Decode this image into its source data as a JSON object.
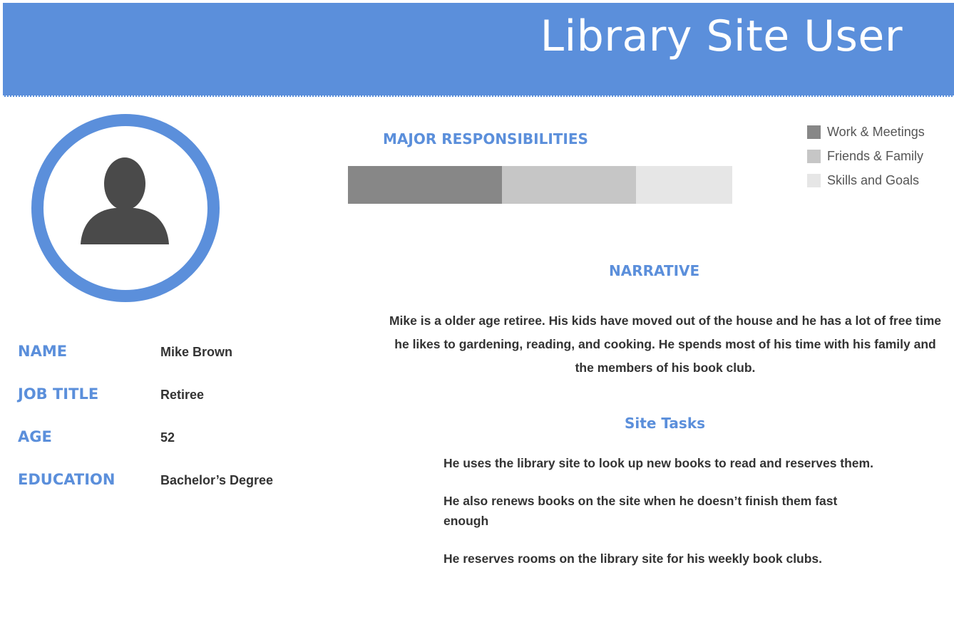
{
  "header": {
    "title": "Library Site User"
  },
  "avatar": {
    "icon": "user-silhouette-icon"
  },
  "profile": [
    {
      "label": "NAME",
      "value": "Mike Brown"
    },
    {
      "label": "JOB TITLE",
      "value": "Retiree"
    },
    {
      "label": "AGE",
      "value": "52"
    },
    {
      "label": "EDUCATION",
      "value": "Bachelor’s Degree"
    }
  ],
  "responsibilities": {
    "title": "MAJOR RESPONSIBILITIES",
    "segments": [
      {
        "name": "Work & Meetings",
        "share": 0.4,
        "color": "#878787"
      },
      {
        "name": "Friends & Family",
        "share": 0.35,
        "color": "#c6c6c6"
      },
      {
        "name": "Skills and Goals",
        "share": 0.25,
        "color": "#e6e6e6"
      }
    ]
  },
  "narrative": {
    "title": "NARRATIVE",
    "text": "Mike is a older age retiree. His kids have moved out of the house and he has a lot of free time he likes to  gardening, reading, and cooking.  He spends most of his time with his family and the members of his book club."
  },
  "site_tasks": {
    "title": "Site Tasks",
    "items": [
      "He uses the library site to look up new books to read and reserves them.",
      "He also renews books on the site when he doesn’t finish them fast enough",
      "He reserves rooms on the library site for his weekly book clubs."
    ]
  },
  "colors": {
    "accent": "#5b8fdb",
    "avatar_fill": "#4a4a4a"
  }
}
